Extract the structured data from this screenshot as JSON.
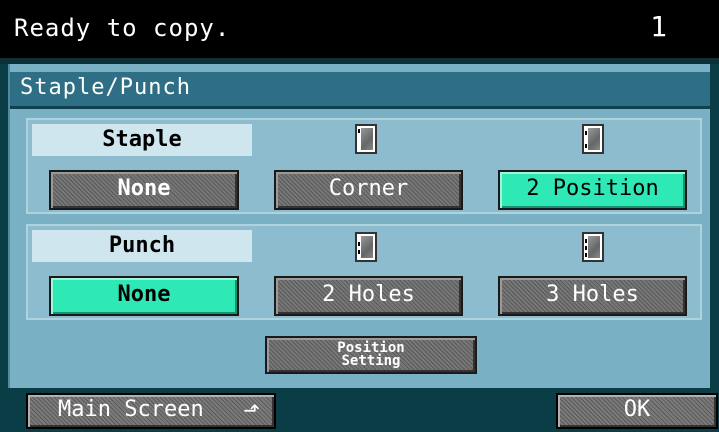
{
  "status": {
    "message": "Ready to copy.",
    "copy_count": "1"
  },
  "panel": {
    "title": "Staple/Punch"
  },
  "staple": {
    "label": "Staple",
    "options": [
      {
        "label": "None",
        "selected": false
      },
      {
        "label": "Corner",
        "selected": false
      },
      {
        "label": "2 Position",
        "selected": true
      }
    ]
  },
  "punch": {
    "label": "Punch",
    "options": [
      {
        "label": "None",
        "selected": true
      },
      {
        "label": "2 Holes",
        "selected": false
      },
      {
        "label": "3 Holes",
        "selected": false
      }
    ]
  },
  "position_setting": {
    "line1": "Position",
    "line2": "Setting"
  },
  "footer": {
    "main_screen": "Main Screen",
    "ok": "OK"
  },
  "colors": {
    "selected": "#2ee8b5",
    "panel": "#7ab0c4",
    "title_bar": "#2f6f86"
  }
}
